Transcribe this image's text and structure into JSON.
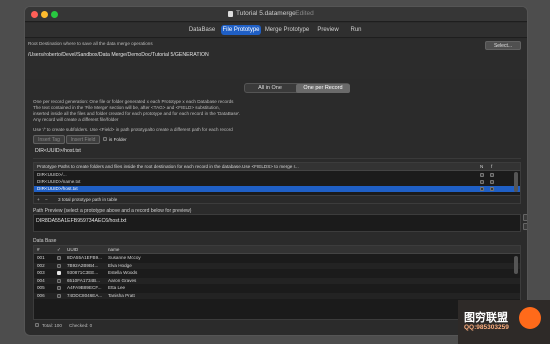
{
  "window": {
    "title": "Tutorial 5.datamerge",
    "edited": "— Edited"
  },
  "tabs": [
    "DataBase",
    "File Prototype",
    "Merge Prototype",
    "Preview",
    "Run"
  ],
  "active_tab_index": 1,
  "root": {
    "label": "Root Destination where to save all the data merge operations",
    "path": "/Users/roberto/Devel/Sandbox/Data Merge/DemoDoc/Tutorial 5/GENERATION",
    "select_button": "Select..."
  },
  "mode": {
    "options": [
      "All in One",
      "One per Record"
    ],
    "selected": 1
  },
  "description": [
    "One per record generation: One file or folder  generated x each Prototype x each Database records",
    "The text contained in the 'File Merge' section will be, after <TAG> and <FIELD> substitution,",
    "inserted inside all the files and folder created for each prototype and for each record in the 'DataBase'.",
    "Any record will create a different file/folder"
  ],
  "subfolder_hint": "Use '/' to create subfolders.  Use <Field> in path prototypalto create a different path for each record",
  "toolbar": {
    "insert_tag": "Insert Tag",
    "insert_field": "Insert Field",
    "is_folder": "is Folder"
  },
  "current_prototype": "DIR<UUID>/host.txt",
  "prototype_table": {
    "header": "Prototype Paths to create folders and  files inside the root destination for each record in the database.Use <FIELDS> to merge r...",
    "col_n": "N",
    "col_f": "f",
    "rows": [
      {
        "path": "DIR<UUID>/...",
        "selected": false
      },
      {
        "path": "DIR<UUID>/name.txt",
        "selected": false
      },
      {
        "path": "DIR<UUID>/host.txt",
        "selected": true
      }
    ],
    "footer": "3 total prototype path in table"
  },
  "path_preview": {
    "label": "Path Preview (select a prototype above and a record below for preview)",
    "value": "DIR8DA55A1EFB959734AEC6/host.txt"
  },
  "database": {
    "label": "Data Base",
    "columns": [
      "#",
      "✓",
      "UUID",
      "name"
    ],
    "rows": [
      {
        "n": "001",
        "checked": false,
        "uuid": "8DA55A1EFB9...",
        "name": "Susanne Mccoy"
      },
      {
        "n": "002",
        "checked": false,
        "uuid": "7B92A2B9B4...",
        "name": "Elva Hodge"
      },
      {
        "n": "003",
        "checked": true,
        "uuid": "930871C3EE...",
        "name": "Estella Woods"
      },
      {
        "n": "004",
        "checked": false,
        "uuid": "6510FA1734B...",
        "name": "Aaron Graves"
      },
      {
        "n": "005",
        "checked": false,
        "uuid": "A4FA9B89ECF...",
        "name": "Etta Lee"
      },
      {
        "n": "006",
        "checked": false,
        "uuid": "74DDC8046EA...",
        "name": "Tanisha Pratt"
      }
    ],
    "footer": {
      "total": "Total: 100",
      "checked": "Checked: 0"
    }
  },
  "watermark": {
    "title": "图穷联盟",
    "qq": "QQ:985303259"
  },
  "colors": {
    "accent": "#1f5fc5",
    "background": "#2b2b2b",
    "watermark_orange": "#ff6a1a"
  }
}
